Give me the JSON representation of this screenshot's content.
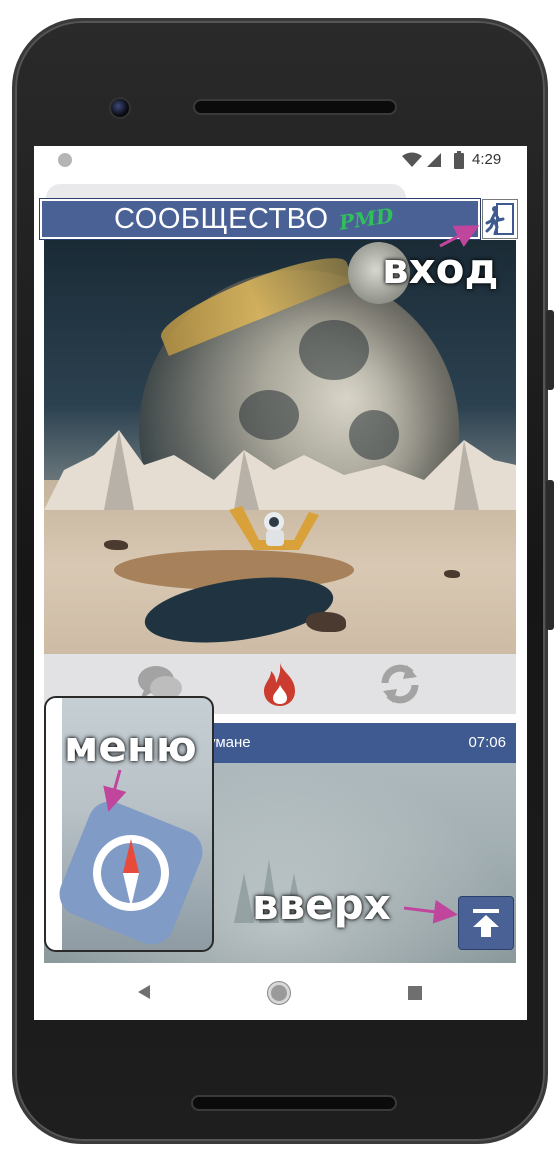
{
  "status_bar": {
    "time": "4:29",
    "icons": [
      "notification-dot-icon",
      "wifi-icon",
      "cell-signal-icon",
      "battery-icon"
    ]
  },
  "header": {
    "title": "СООБЩЕСТВО",
    "logo_text": "PMD",
    "login_icon": "exit-door-icon",
    "banner_color": "#4a6196"
  },
  "hero": {
    "image": "astronaut-on-moon-illustration"
  },
  "actions": {
    "items": [
      {
        "name": "comments",
        "icon": "chat-bubbles-icon",
        "color": "#a3a3a3"
      },
      {
        "name": "hot",
        "icon": "fire-icon",
        "color": "#cc3b2f"
      },
      {
        "name": "repost",
        "icon": "refresh-icon",
        "color": "#a3a3a3"
      }
    ]
  },
  "post": {
    "title": "умане",
    "time": "07:06",
    "header_color": "#3e5a90"
  },
  "scroll_top": {
    "icon": "arrow-up-to-line-icon"
  },
  "menu": {
    "icon": "compass-icon"
  },
  "annotations": {
    "login": "вход",
    "menu": "меню",
    "up": "вверх",
    "arrow_color": "#c0469d"
  },
  "navbar": {
    "icons": [
      "back-triangle-icon",
      "home-circle-icon",
      "recent-square-icon"
    ]
  }
}
